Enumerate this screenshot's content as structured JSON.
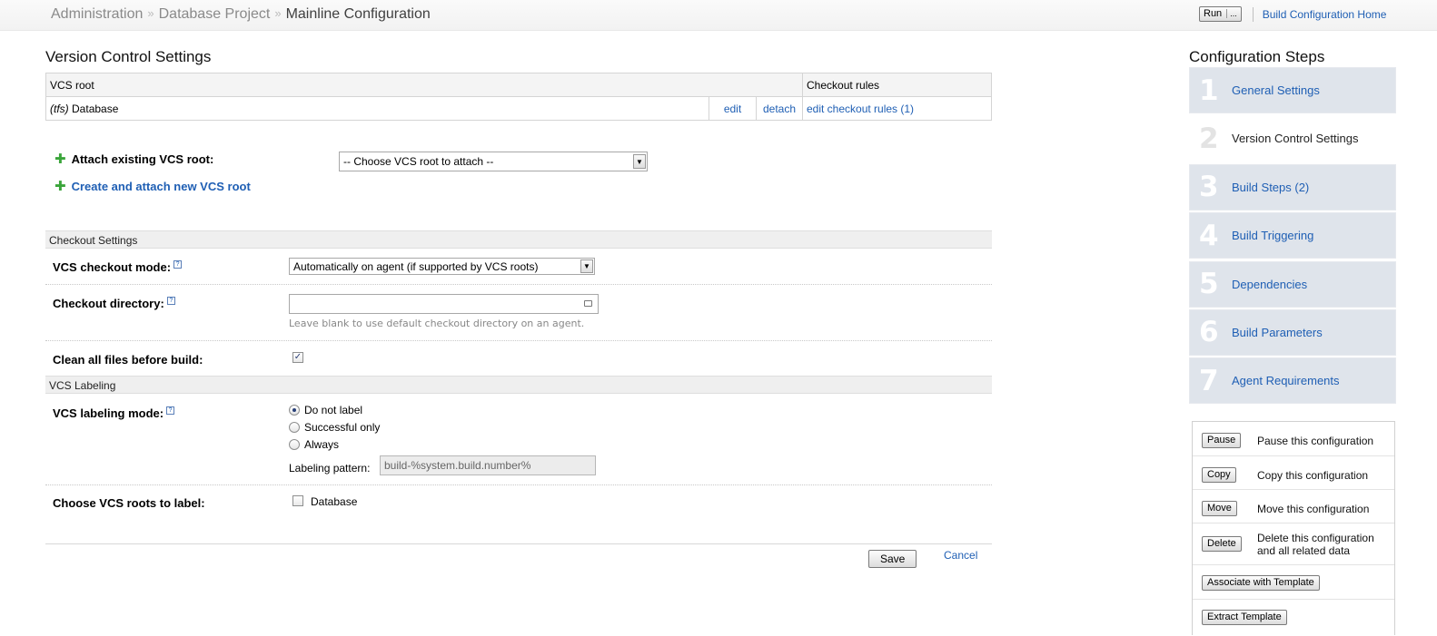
{
  "breadcrumb": {
    "items": [
      "Administration",
      "Database Project"
    ],
    "current": "Mainline Configuration",
    "separator": "»"
  },
  "top_actions": {
    "run_label": "Run",
    "run_more_label": "...",
    "home_link": "Build Configuration Home"
  },
  "vcs_section": {
    "title": "Version Control Settings",
    "table": {
      "col_vcs_root": "VCS root",
      "col_checkout_rules": "Checkout rules",
      "rows": [
        {
          "type": "(tfs)",
          "name": "Database",
          "edit": "edit",
          "detach": "detach",
          "rules": "edit checkout rules (1)"
        }
      ]
    },
    "attach_label": "Attach existing VCS root:",
    "attach_select": "-- Choose VCS root to attach --",
    "create_link": "Create and attach new VCS root"
  },
  "checkout_settings": {
    "header": "Checkout Settings",
    "mode_label": "VCS checkout mode:",
    "mode_value": "Automatically on agent (if supported by VCS roots)",
    "dir_label": "Checkout directory:",
    "dir_value": "",
    "dir_hint": "Leave blank to use default checkout directory on an agent.",
    "clean_label": "Clean all files before build:",
    "clean_checked": true
  },
  "vcs_labeling": {
    "header": "VCS Labeling",
    "mode_label": "VCS labeling mode:",
    "options": [
      "Do not label",
      "Successful only",
      "Always"
    ],
    "selected": "Do not label",
    "pattern_label": "Labeling pattern:",
    "pattern_value": "build-%system.build.number%",
    "roots_label": "Choose VCS roots to label:",
    "roots": [
      {
        "name": "Database",
        "checked": false
      }
    ]
  },
  "form_buttons": {
    "save": "Save",
    "cancel": "Cancel"
  },
  "sidebar": {
    "title": "Configuration Steps",
    "steps": [
      {
        "num": "1",
        "label": "General Settings",
        "active": false
      },
      {
        "num": "2",
        "label": "Version Control Settings",
        "active": true
      },
      {
        "num": "3",
        "label": "Build Steps (2)",
        "active": false
      },
      {
        "num": "4",
        "label": "Build Triggering",
        "active": false
      },
      {
        "num": "5",
        "label": "Dependencies",
        "active": false
      },
      {
        "num": "6",
        "label": "Build Parameters",
        "active": false
      },
      {
        "num": "7",
        "label": "Agent Requirements",
        "active": false
      }
    ],
    "actions": [
      {
        "button": "Pause",
        "text": "Pause this configuration"
      },
      {
        "button": "Copy",
        "text": "Copy this configuration"
      },
      {
        "button": "Move",
        "text": "Move this configuration"
      },
      {
        "button": "Delete",
        "text": "Delete this configuration and all related data"
      },
      {
        "button": "Associate with Template",
        "text": ""
      },
      {
        "button": "Extract Template",
        "text": ""
      }
    ]
  },
  "icons": {
    "help": "help-icon",
    "plus": "plus-icon",
    "dropdown": "chevron-down-icon"
  },
  "colors": {
    "link": "#1f5fb4",
    "step_bg": "#dfe4eb",
    "plus": "#3aa53a"
  }
}
